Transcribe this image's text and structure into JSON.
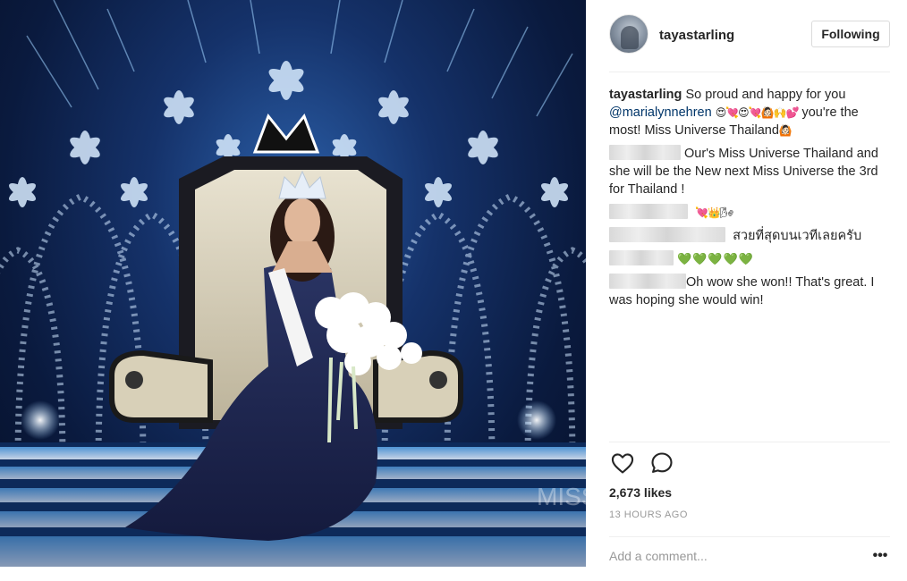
{
  "post": {
    "username": "tayastarling",
    "follow_label": "Following",
    "caption": {
      "user": "tayastarling",
      "text_before": "So proud and happy for you",
      "mention": "@marialynnehren",
      "emojis_1": "😍💘😍💘🙆🏻🙌💕",
      "text_after": "you're the most! Miss Universe Thailand",
      "emojis_2": "🙆🏻"
    },
    "comments": [
      {
        "text": "Our's Miss Universe Thailand and she will be the New next Miss Universe the 3rd for Thailand !"
      },
      {
        "text": "",
        "emojis": "💘👑🌬"
      },
      {
        "text": "สวยที่สุดบนเวทีเลยครับ"
      },
      {
        "text": "",
        "emojis": "💚💚💚💚💚"
      },
      {
        "text": "Oh wow she won!! That's great. I was hoping she would win!"
      }
    ],
    "likes": "2,673 likes",
    "timestamp": "13 HOURS AGO",
    "add_comment_placeholder": "Add a comment...",
    "more_label": "•••",
    "photo_watermark": "MISS",
    "icons": [
      "heart-icon",
      "comment-icon",
      "more-options-icon"
    ]
  }
}
